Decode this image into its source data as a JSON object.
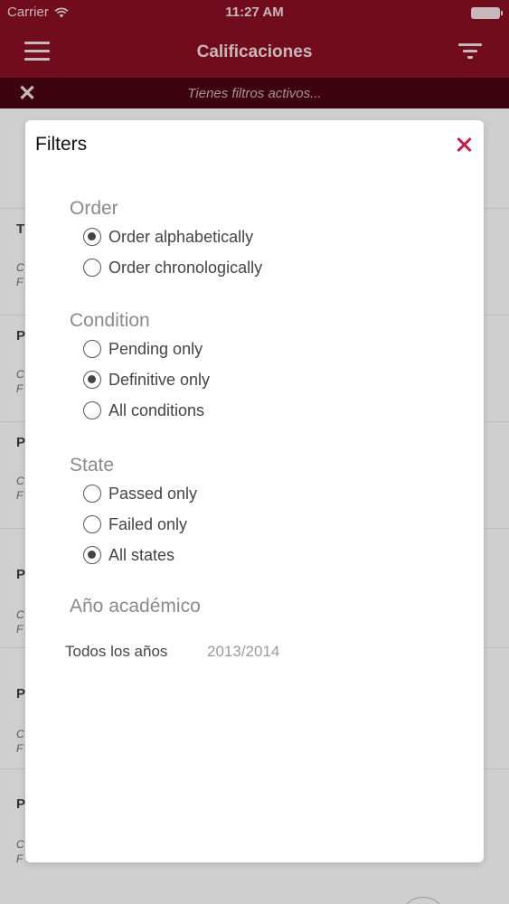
{
  "status_bar": {
    "carrier": "Carrier",
    "time": "11:27 AM",
    "wifi_icon": "wifi-icon",
    "battery_icon": "battery-icon"
  },
  "nav": {
    "title": "Calificaciones",
    "menu_icon": "hamburger-menu-icon",
    "filter_icon": "filter-icon"
  },
  "filter_bar": {
    "message": "Tienes filtros activos...",
    "clear_icon": "close-icon"
  },
  "background_rows": [
    {
      "lead": "T",
      "sub1": "C",
      "sub2": "F"
    },
    {
      "lead": "P",
      "sub1": "C",
      "sub2": "F"
    },
    {
      "lead": "P",
      "sub1": "C",
      "sub2": "F"
    },
    {
      "lead": "P",
      "sub1": "C",
      "sub2": "F"
    },
    {
      "lead": "P",
      "sub1": "C",
      "sub2": "F"
    },
    {
      "lead": "P",
      "sub1": "C",
      "sub2": "F"
    }
  ],
  "modal": {
    "title": "Filters",
    "close_icon": "close-icon",
    "accent_color": "#c41f44",
    "order": {
      "title": "Order",
      "options": [
        {
          "label": "Order alphabetically",
          "checked": true
        },
        {
          "label": "Order chronologically",
          "checked": false
        }
      ]
    },
    "condition": {
      "title": "Condition",
      "options": [
        {
          "label": "Pending only",
          "checked": false
        },
        {
          "label": "Definitive only",
          "checked": true
        },
        {
          "label": "All conditions",
          "checked": false
        }
      ]
    },
    "state": {
      "title": "State",
      "options": [
        {
          "label": "Passed only",
          "checked": false
        },
        {
          "label": "Failed only",
          "checked": false
        },
        {
          "label": "All states",
          "checked": true
        }
      ]
    },
    "academic_year": {
      "title": "Año académico",
      "label": "Todos los años",
      "value": "2013/2014"
    }
  }
}
